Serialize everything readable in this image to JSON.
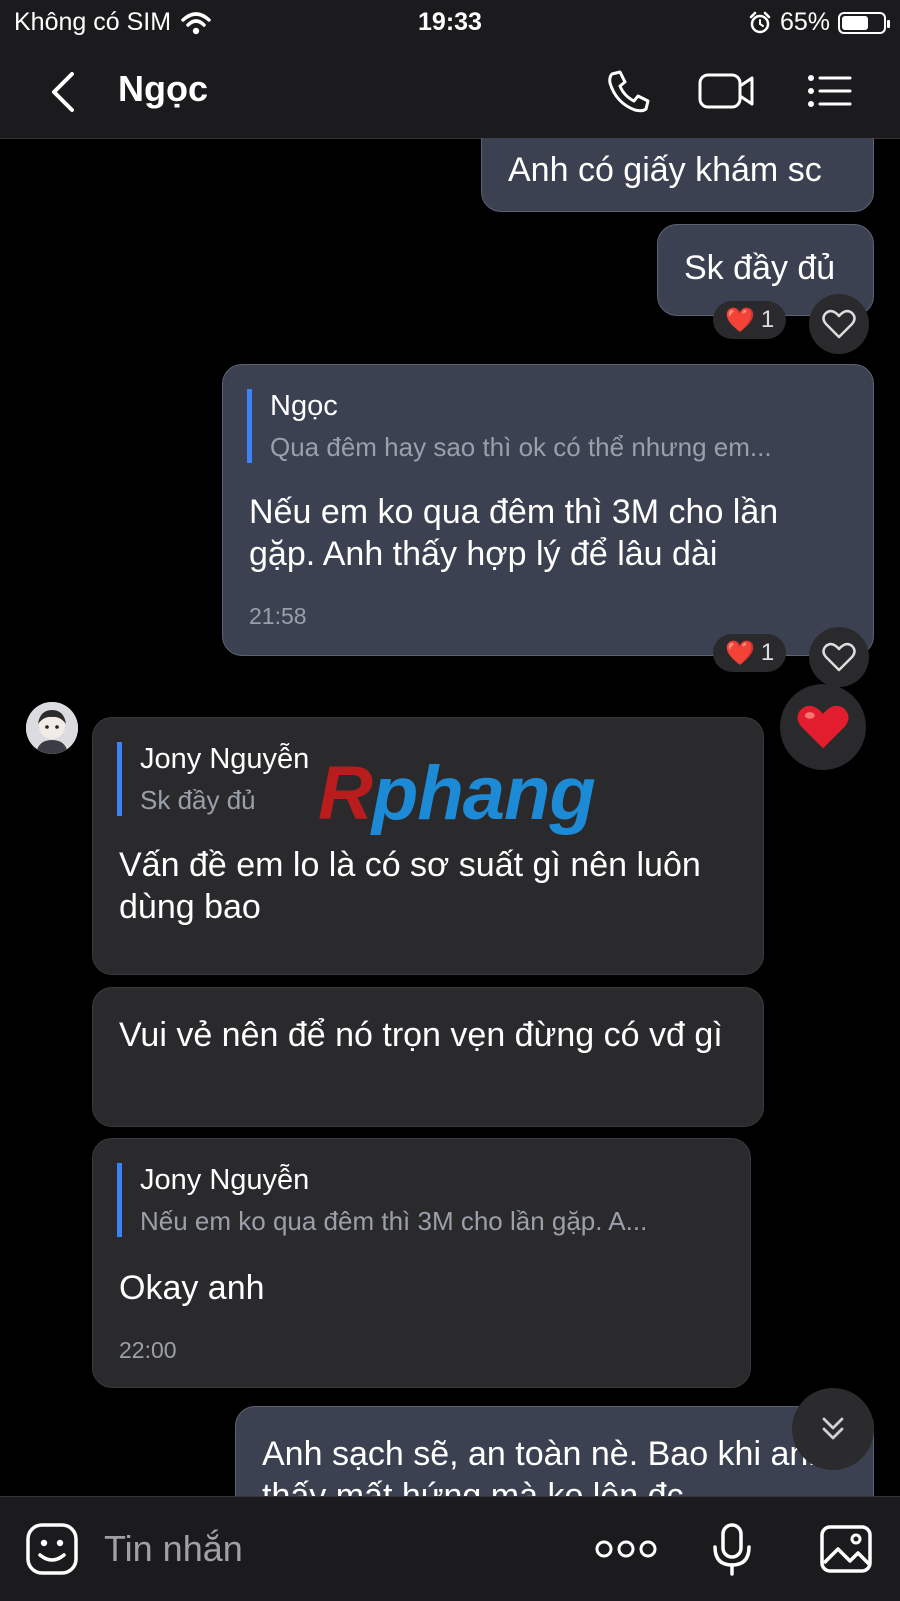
{
  "status_bar": {
    "carrier": "Không có SIM",
    "time": "19:33",
    "battery": "65%",
    "battery_level": 0.65
  },
  "header": {
    "contact_name": "Ngọc"
  },
  "messages": [
    {
      "text": "Anh có giấy khám sc"
    },
    {
      "text": "Sk đầy đủ",
      "reaction": {
        "emoji": "❤️",
        "count": "1"
      }
    },
    {
      "quote": {
        "name": "Ngọc",
        "text": "Qua đêm hay sao thì ok có thể nhưng em..."
      },
      "text": "Nếu em ko qua đêm thì 3M cho lần gặp. Anh thấy hợp lý để lâu dài",
      "time": "21:58",
      "reaction": {
        "emoji": "❤️",
        "count": "1"
      }
    },
    {
      "quote": {
        "name": "Jony Nguyễn",
        "text": "Sk đầy đủ"
      },
      "text": "Vấn đề em lo là có sơ suất gì nên luôn dùng bao"
    },
    {
      "text": "Vui vẻ nên để nó trọn vẹn đừng có vđ gì"
    },
    {
      "quote": {
        "name": "Jony Nguyễn",
        "text": "Nếu em ko qua đêm thì 3M cho lần gặp. A..."
      },
      "text": "Okay anh",
      "time": "22:00"
    },
    {
      "text": "Anh sạch sẽ, an toàn nè. Bao khi anh thấy mất hứng mà ko lên đc"
    }
  ],
  "watermark": {
    "first": "R",
    "rest": "phang"
  },
  "composer": {
    "placeholder": "Tin nhắn"
  },
  "colors": {
    "background": "#000000",
    "outgoing_bubble": "#3b4150",
    "incoming_bubble": "#2a2a2d",
    "quote_bar": "#3b82f6",
    "heart": "#e11d2e"
  }
}
